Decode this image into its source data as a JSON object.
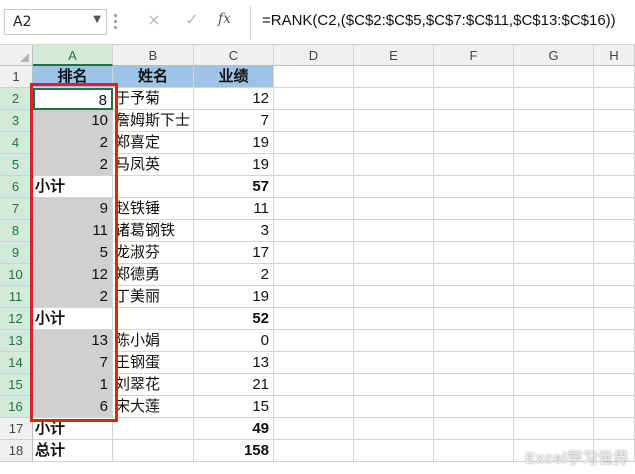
{
  "name_box": "A2",
  "formula_bar": {
    "cancel_icon": "×",
    "enter_icon": "✓",
    "fx_label": "fx",
    "formula": "=RANK(C2,($C$2:$C$5,$C$7:$C$11,$C$13:$C$16))"
  },
  "columns": [
    "A",
    "B",
    "C",
    "D",
    "E",
    "F",
    "G",
    "H"
  ],
  "rows": [
    {
      "n": "1",
      "a": "排名",
      "b": "姓名",
      "c": "业绩",
      "type": "header"
    },
    {
      "n": "2",
      "a": "8",
      "b": "于予菊",
      "c": "12",
      "type": "data"
    },
    {
      "n": "3",
      "a": "10",
      "b": "詹姆斯下士",
      "c": "7",
      "type": "data"
    },
    {
      "n": "4",
      "a": "2",
      "b": "郑喜定",
      "c": "19",
      "type": "data"
    },
    {
      "n": "5",
      "a": "2",
      "b": "马凤英",
      "c": "19",
      "type": "data"
    },
    {
      "n": "6",
      "a": "小计",
      "b": "",
      "c": "57",
      "type": "subtotal"
    },
    {
      "n": "7",
      "a": "9",
      "b": "赵铁锤",
      "c": "11",
      "type": "data"
    },
    {
      "n": "8",
      "a": "11",
      "b": "诸葛钢铁",
      "c": "3",
      "type": "data"
    },
    {
      "n": "9",
      "a": "5",
      "b": "龙淑芬",
      "c": "17",
      "type": "data"
    },
    {
      "n": "10",
      "a": "12",
      "b": "郑德勇",
      "c": "2",
      "type": "data"
    },
    {
      "n": "11",
      "a": "2",
      "b": "丁美丽",
      "c": "19",
      "type": "data"
    },
    {
      "n": "12",
      "a": "小计",
      "b": "",
      "c": "52",
      "type": "subtotal"
    },
    {
      "n": "13",
      "a": "13",
      "b": "陈小娟",
      "c": "0",
      "type": "data"
    },
    {
      "n": "14",
      "a": "7",
      "b": "王钢蛋",
      "c": "13",
      "type": "data"
    },
    {
      "n": "15",
      "a": "1",
      "b": "刘翠花",
      "c": "21",
      "type": "data"
    },
    {
      "n": "16",
      "a": "6",
      "b": "宋大莲",
      "c": "15",
      "type": "data"
    },
    {
      "n": "17",
      "a": "小计",
      "b": "",
      "c": "49",
      "type": "subtotal"
    },
    {
      "n": "18",
      "a": "总计",
      "b": "",
      "c": "158",
      "type": "subtotal"
    }
  ],
  "watermark": "Excel学习世界",
  "colors": {
    "header_fill": "#9dc3e6",
    "selection_fill": "#d0d0d0",
    "highlight_border": "#e0201d",
    "excel_green": "#217346"
  }
}
